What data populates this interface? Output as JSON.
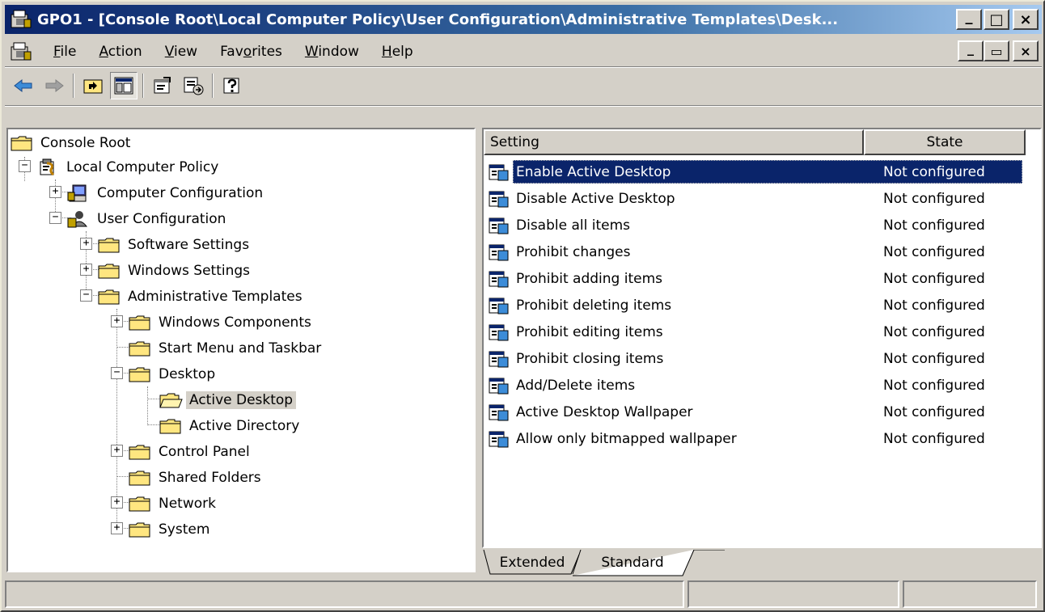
{
  "window": {
    "title": "GPO1 - [Console Root\\Local Computer Policy\\User Configuration\\Administrative Templates\\Desk...",
    "minimize": "_",
    "maximize": "□",
    "close": "×"
  },
  "menubar": {
    "items": [
      {
        "pre": "",
        "key": "F",
        "post": "ile"
      },
      {
        "pre": "",
        "key": "A",
        "post": "ction"
      },
      {
        "pre": "",
        "key": "V",
        "post": "iew"
      },
      {
        "pre": "Fav",
        "key": "o",
        "post": "rites"
      },
      {
        "pre": "",
        "key": "W",
        "post": "indow"
      },
      {
        "pre": "",
        "key": "H",
        "post": "elp"
      }
    ],
    "mdi_minimize": "_",
    "mdi_restore": "▭",
    "mdi_close": "×"
  },
  "toolbar": {
    "icons": [
      "back-icon",
      "forward-icon",
      "up-one-level-icon",
      "show-hide-tree-icon",
      "properties-icon",
      "export-list-icon",
      "help-icon"
    ]
  },
  "tree": {
    "items": [
      {
        "label": "Console Root",
        "icon": "folder-icon"
      },
      {
        "label": "Local Computer Policy",
        "icon": "policy-icon",
        "expander": "−"
      },
      {
        "label": "Computer Configuration",
        "icon": "computer-icon",
        "expander": "+"
      },
      {
        "label": "User Configuration",
        "icon": "user-config-icon",
        "expander": "−"
      },
      {
        "label": "Software Settings",
        "icon": "folder-icon",
        "expander": "+"
      },
      {
        "label": "Windows Settings",
        "icon": "folder-icon",
        "expander": "+"
      },
      {
        "label": "Administrative Templates",
        "icon": "folder-icon",
        "expander": "−"
      },
      {
        "label": "Windows Components",
        "icon": "folder-icon",
        "expander": "+"
      },
      {
        "label": "Start Menu and Taskbar",
        "icon": "folder-icon"
      },
      {
        "label": "Desktop",
        "icon": "folder-icon",
        "expander": "−"
      },
      {
        "label": "Active Desktop",
        "icon": "open-folder-icon",
        "selected": true
      },
      {
        "label": "Active Directory",
        "icon": "folder-icon"
      },
      {
        "label": "Control Panel",
        "icon": "folder-icon",
        "expander": "+"
      },
      {
        "label": "Shared Folders",
        "icon": "folder-icon"
      },
      {
        "label": "Network",
        "icon": "folder-icon",
        "expander": "+"
      },
      {
        "label": "System",
        "icon": "folder-icon",
        "expander": "+"
      }
    ]
  },
  "list": {
    "columns": {
      "setting": "Setting",
      "state": "State"
    },
    "rows": [
      {
        "setting": "Enable Active Desktop",
        "state": "Not configured",
        "selected": true
      },
      {
        "setting": "Disable Active Desktop",
        "state": "Not configured"
      },
      {
        "setting": "Disable all items",
        "state": "Not configured"
      },
      {
        "setting": "Prohibit changes",
        "state": "Not configured"
      },
      {
        "setting": "Prohibit adding items",
        "state": "Not configured"
      },
      {
        "setting": "Prohibit deleting items",
        "state": "Not configured"
      },
      {
        "setting": "Prohibit editing items",
        "state": "Not configured"
      },
      {
        "setting": "Prohibit closing items",
        "state": "Not configured"
      },
      {
        "setting": "Add/Delete items",
        "state": "Not configured"
      },
      {
        "setting": "Active Desktop Wallpaper",
        "state": "Not configured"
      },
      {
        "setting": "Allow only bitmapped wallpaper",
        "state": "Not configured"
      }
    ]
  },
  "tabs": {
    "extended": "Extended",
    "standard": "Standard",
    "active": "Standard"
  },
  "colors": {
    "titlebar_start": "#0a246a",
    "titlebar_end": "#a6caf0",
    "selection": "#0a246a",
    "face": "#d4d0c8"
  }
}
